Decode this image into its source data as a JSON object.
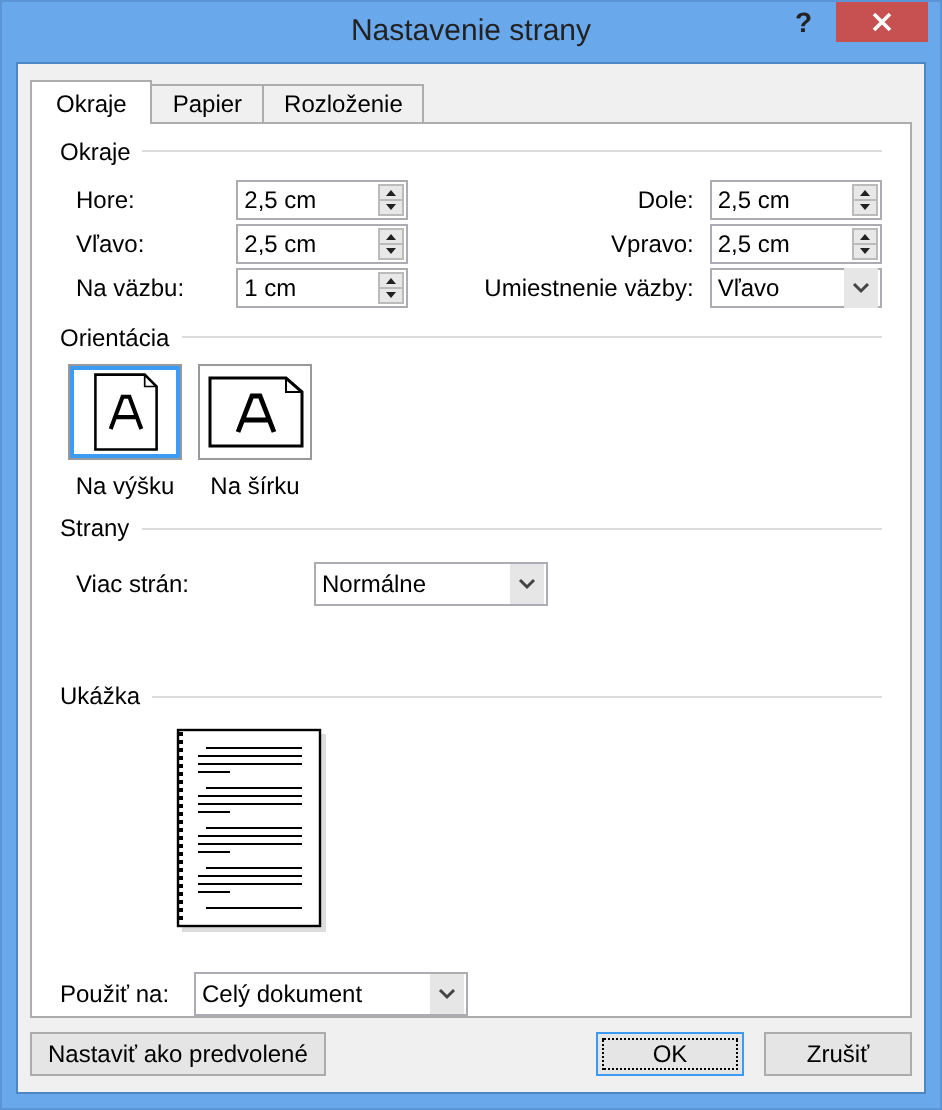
{
  "window": {
    "title": "Nastavenie strany",
    "help": "?"
  },
  "tabs": [
    {
      "label": "Okraje",
      "selected": true
    },
    {
      "label": "Papier",
      "selected": false
    },
    {
      "label": "Rozloženie",
      "selected": false
    }
  ],
  "margins": {
    "title": "Okraje",
    "rows": [
      {
        "left": {
          "label": "Hore:",
          "value": "2,5 cm",
          "kind": "spin"
        },
        "right": {
          "label": "Dole:",
          "value": "2,5 cm",
          "kind": "spin"
        }
      },
      {
        "left": {
          "label": "Vľavo:",
          "value": "2,5 cm",
          "kind": "spin"
        },
        "right": {
          "label": "Vpravo:",
          "value": "2,5 cm",
          "kind": "spin"
        }
      },
      {
        "left": {
          "label": "Na väzbu:",
          "value": "1 cm",
          "kind": "spin"
        },
        "right": {
          "label": "Umiestnenie väzby:",
          "value": "Vľavo",
          "kind": "dropdown"
        }
      }
    ]
  },
  "orientation": {
    "title": "Orientácia",
    "options": [
      {
        "label": "Na výšku",
        "kind": "portrait",
        "selected": true
      },
      {
        "label": "Na šírku",
        "kind": "landscape",
        "selected": false
      }
    ]
  },
  "pages": {
    "title": "Strany",
    "label": "Viac strán:",
    "value": "Normálne"
  },
  "preview": {
    "title": "Ukážka"
  },
  "apply": {
    "label": "Použiť na:",
    "value": "Celý dokument"
  },
  "buttons": [
    {
      "label": "Nastaviť ako predvolené",
      "kind": "left",
      "focused": false
    },
    {
      "label": "OK",
      "kind": "right",
      "focused": true
    },
    {
      "label": "Zrušiť",
      "kind": "right",
      "focused": false
    }
  ]
}
